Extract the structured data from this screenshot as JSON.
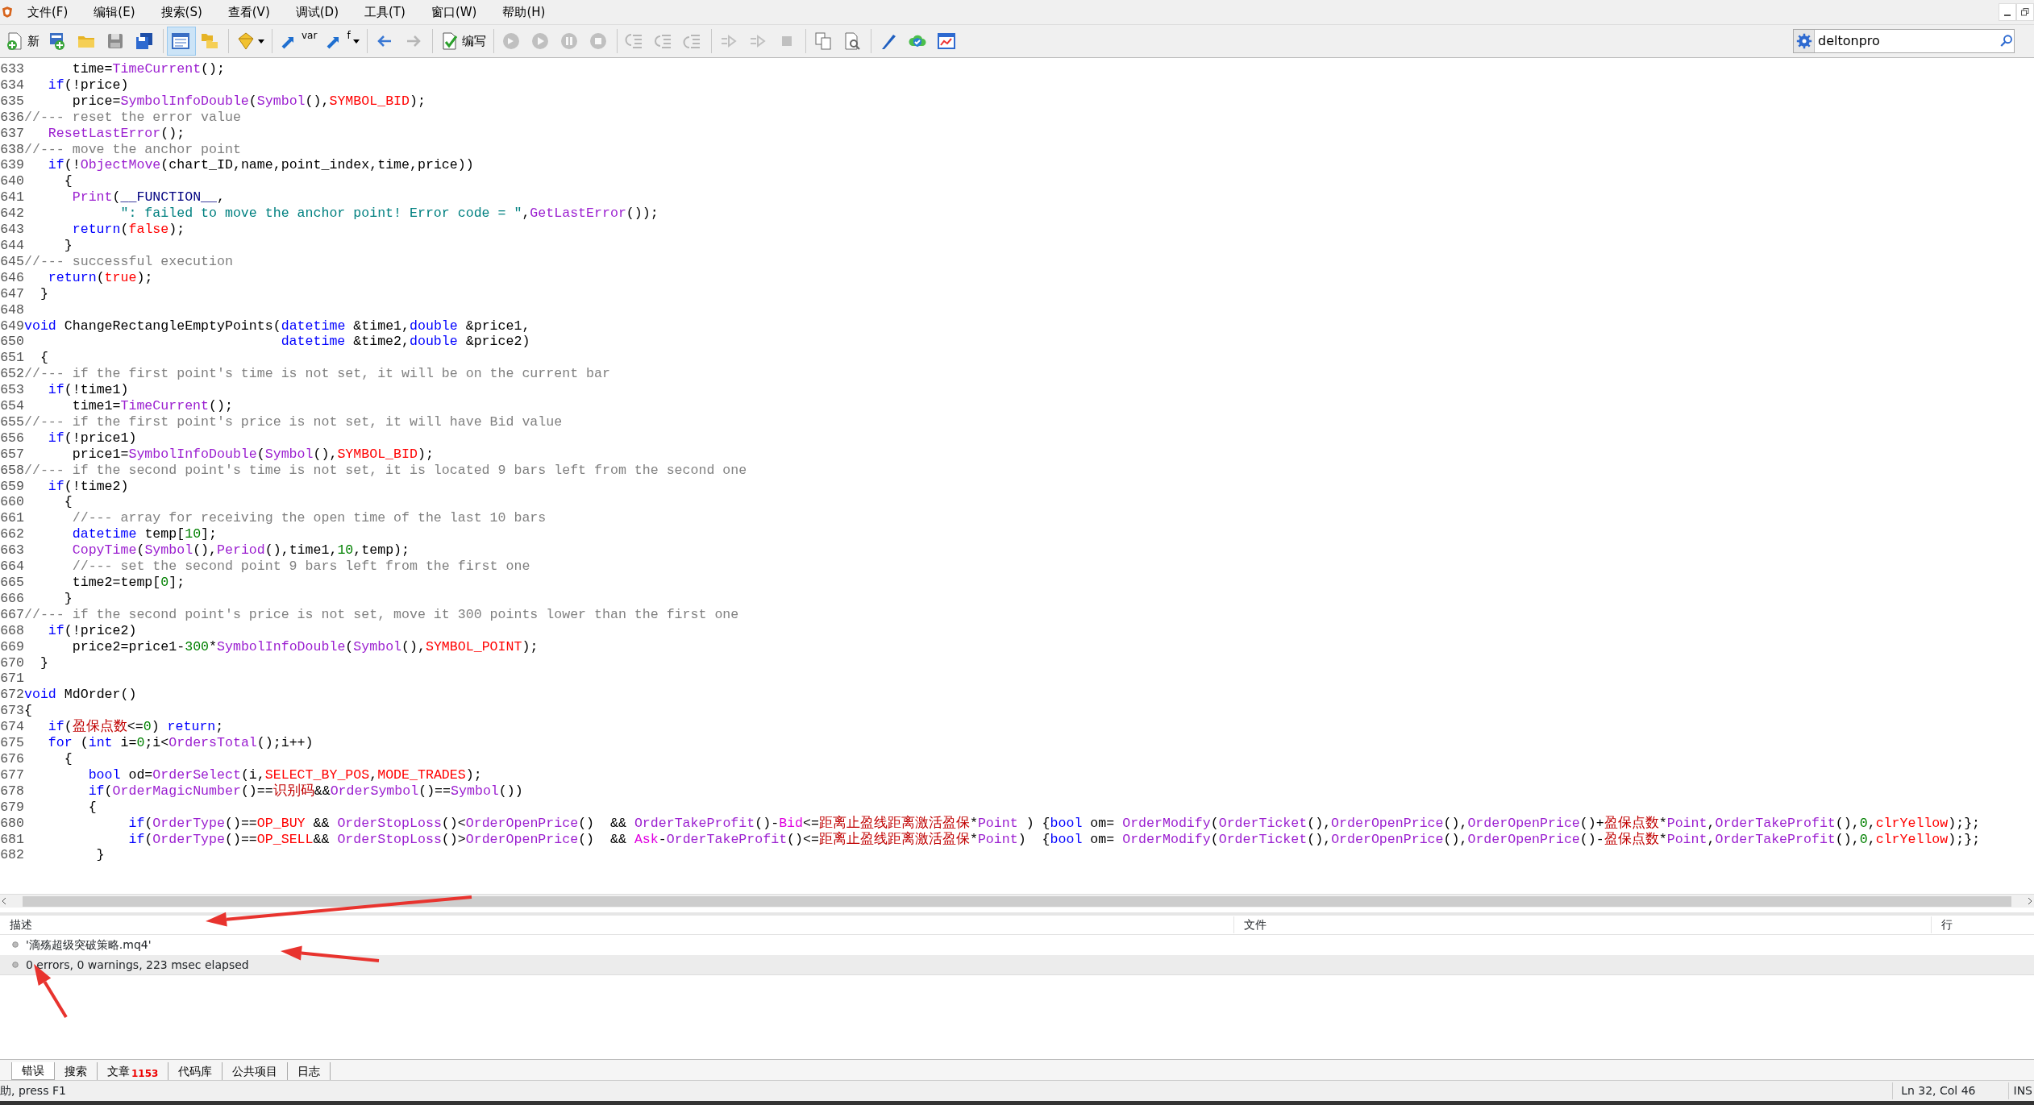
{
  "menu": [
    {
      "label": "文件(F)"
    },
    {
      "label": "编辑(E)"
    },
    {
      "label": "搜索(S)"
    },
    {
      "label": "查看(V)"
    },
    {
      "label": "调试(D)"
    },
    {
      "label": "工具(T)"
    },
    {
      "label": "窗口(W)"
    },
    {
      "label": "帮助(H)"
    }
  ],
  "toolbar": [
    {
      "kind": "button",
      "label": "新",
      "disabled": false,
      "selected": false
    },
    {
      "kind": "button",
      "disabled": false,
      "selected": false
    },
    {
      "kind": "button",
      "disabled": false,
      "selected": false
    },
    {
      "kind": "button",
      "disabled": false,
      "selected": false
    },
    {
      "kind": "button",
      "disabled": false,
      "selected": false
    },
    {
      "kind": "separator"
    },
    {
      "kind": "button",
      "disabled": false,
      "selected": true
    },
    {
      "kind": "button",
      "disabled": false,
      "selected": false
    },
    {
      "kind": "separator"
    },
    {
      "kind": "dropdown",
      "disabled": false,
      "selected": false
    },
    {
      "kind": "separator"
    },
    {
      "kind": "button",
      "caption": "var",
      "disabled": false,
      "selected": false
    },
    {
      "kind": "dropdown",
      "caption": "f",
      "disabled": false,
      "selected": false
    },
    {
      "kind": "separator"
    },
    {
      "kind": "button",
      "disabled": false,
      "selected": false
    },
    {
      "kind": "button",
      "disabled": true,
      "selected": false
    },
    {
      "kind": "separator"
    },
    {
      "kind": "button",
      "label": "编写",
      "disabled": false,
      "selected": false
    },
    {
      "kind": "separator"
    },
    {
      "kind": "button",
      "disabled": true,
      "selected": false
    },
    {
      "kind": "button",
      "disabled": true,
      "selected": false
    },
    {
      "kind": "button",
      "disabled": true,
      "selected": false
    },
    {
      "kind": "button",
      "disabled": true,
      "selected": false
    },
    {
      "kind": "separator"
    },
    {
      "kind": "button",
      "disabled": true,
      "selected": false
    },
    {
      "kind": "button",
      "disabled": true,
      "selected": false
    },
    {
      "kind": "button",
      "disabled": true,
      "selected": false
    },
    {
      "kind": "separator"
    },
    {
      "kind": "button",
      "disabled": true,
      "selected": false
    },
    {
      "kind": "button",
      "disabled": true,
      "selected": false
    },
    {
      "kind": "button",
      "disabled": true,
      "selected": false
    },
    {
      "kind": "separator"
    },
    {
      "kind": "button",
      "disabled": false,
      "selected": false
    },
    {
      "kind": "button",
      "disabled": false,
      "selected": false
    },
    {
      "kind": "separator"
    },
    {
      "kind": "button",
      "disabled": false,
      "selected": false
    },
    {
      "kind": "button",
      "disabled": false,
      "selected": false
    },
    {
      "kind": "button",
      "disabled": false,
      "selected": false
    }
  ],
  "search": {
    "value": "deltonpro"
  },
  "code_lines": [
    {
      "number": "633",
      "tokens": [
        {
          "text": "      time=",
          "kind": "plain"
        },
        {
          "text": "TimeCurrent",
          "kind": "function"
        },
        {
          "text": "();",
          "kind": "plain"
        }
      ]
    },
    {
      "number": "634",
      "tokens": [
        {
          "text": "   if",
          "kind": "keyword"
        },
        {
          "text": "(!price)",
          "kind": "plain"
        }
      ]
    },
    {
      "number": "635",
      "tokens": [
        {
          "text": "      price=",
          "kind": "plain"
        },
        {
          "text": "SymbolInfoDouble",
          "kind": "function"
        },
        {
          "text": "(",
          "kind": "plain"
        },
        {
          "text": "Symbol",
          "kind": "function"
        },
        {
          "text": "(),",
          "kind": "plain"
        },
        {
          "text": "SYMBOL_BID",
          "kind": "constant"
        },
        {
          "text": ");",
          "kind": "plain"
        }
      ]
    },
    {
      "number": "636",
      "tokens": [
        {
          "text": "//--- reset the error value",
          "kind": "comment"
        }
      ]
    },
    {
      "number": "637",
      "tokens": [
        {
          "text": "   ResetLastError",
          "kind": "function"
        },
        {
          "text": "();",
          "kind": "plain"
        }
      ]
    },
    {
      "number": "638",
      "tokens": [
        {
          "text": "//--- move the anchor point",
          "kind": "comment"
        }
      ]
    },
    {
      "number": "639",
      "tokens": [
        {
          "text": "   if",
          "kind": "keyword"
        },
        {
          "text": "(!",
          "kind": "plain"
        },
        {
          "text": "ObjectMove",
          "kind": "function"
        },
        {
          "text": "(chart_ID,name,point_index,time,price))",
          "kind": "plain"
        }
      ]
    },
    {
      "number": "640",
      "tokens": [
        {
          "text": "     {",
          "kind": "plain"
        }
      ]
    },
    {
      "number": "641",
      "tokens": [
        {
          "text": "      Print",
          "kind": "function"
        },
        {
          "text": "(",
          "kind": "plain"
        },
        {
          "text": "__FUNCTION__",
          "kind": "macro"
        },
        {
          "text": ",",
          "kind": "plain"
        }
      ]
    },
    {
      "number": "642",
      "tokens": [
        {
          "text": "            \": failed to move the anchor point! Error code = \"",
          "kind": "string"
        },
        {
          "text": ",",
          "kind": "plain"
        },
        {
          "text": "GetLastError",
          "kind": "function"
        },
        {
          "text": "());",
          "kind": "plain"
        }
      ]
    },
    {
      "number": "643",
      "tokens": [
        {
          "text": "      return",
          "kind": "keyword"
        },
        {
          "text": "(",
          "kind": "plain"
        },
        {
          "text": "false",
          "kind": "constant"
        },
        {
          "text": ");",
          "kind": "plain"
        }
      ]
    },
    {
      "number": "644",
      "tokens": [
        {
          "text": "     }",
          "kind": "plain"
        }
      ]
    },
    {
      "number": "645",
      "tokens": [
        {
          "text": "//--- successful execution",
          "kind": "comment"
        }
      ]
    },
    {
      "number": "646",
      "tokens": [
        {
          "text": "   return",
          "kind": "keyword"
        },
        {
          "text": "(",
          "kind": "plain"
        },
        {
          "text": "true",
          "kind": "constant"
        },
        {
          "text": ");",
          "kind": "plain"
        }
      ]
    },
    {
      "number": "647",
      "tokens": [
        {
          "text": "  }",
          "kind": "plain"
        }
      ]
    },
    {
      "number": "648"
    },
    {
      "number": "649",
      "tokens": [
        {
          "text": "void",
          "kind": "keyword"
        },
        {
          "text": " ChangeRectangleEmptyPoints(",
          "kind": "plain"
        },
        {
          "text": "datetime",
          "kind": "keyword"
        },
        {
          "text": " &time1,",
          "kind": "plain"
        },
        {
          "text": "double",
          "kind": "keyword"
        },
        {
          "text": " &price1,",
          "kind": "plain"
        }
      ]
    },
    {
      "number": "650",
      "tokens": [
        {
          "text": "                                datetime",
          "kind": "keyword"
        },
        {
          "text": " &time2,",
          "kind": "plain"
        },
        {
          "text": "double",
          "kind": "keyword"
        },
        {
          "text": " &price2)",
          "kind": "plain"
        }
      ]
    },
    {
      "number": "651",
      "tokens": [
        {
          "text": "  {",
          "kind": "plain"
        }
      ]
    },
    {
      "number": "652",
      "tokens": [
        {
          "text": "//--- if the first point's time is not set, it will be on the current bar",
          "kind": "comment"
        }
      ]
    },
    {
      "number": "653",
      "tokens": [
        {
          "text": "   if",
          "kind": "keyword"
        },
        {
          "text": "(!time1)",
          "kind": "plain"
        }
      ]
    },
    {
      "number": "654",
      "tokens": [
        {
          "text": "      time1=",
          "kind": "plain"
        },
        {
          "text": "TimeCurrent",
          "kind": "function"
        },
        {
          "text": "();",
          "kind": "plain"
        }
      ]
    },
    {
      "number": "655",
      "tokens": [
        {
          "text": "//--- if the first point's price is not set, it will have Bid value",
          "kind": "comment"
        }
      ]
    },
    {
      "number": "656",
      "tokens": [
        {
          "text": "   if",
          "kind": "keyword"
        },
        {
          "text": "(!price1)",
          "kind": "plain"
        }
      ]
    },
    {
      "number": "657",
      "tokens": [
        {
          "text": "      price1=",
          "kind": "plain"
        },
        {
          "text": "SymbolInfoDouble",
          "kind": "function"
        },
        {
          "text": "(",
          "kind": "plain"
        },
        {
          "text": "Symbol",
          "kind": "function"
        },
        {
          "text": "(),",
          "kind": "plain"
        },
        {
          "text": "SYMBOL_BID",
          "kind": "constant"
        },
        {
          "text": ");",
          "kind": "plain"
        }
      ]
    },
    {
      "number": "658",
      "tokens": [
        {
          "text": "//--- if the second point's time is not set, it is located 9 bars left from the second one",
          "kind": "comment"
        }
      ]
    },
    {
      "number": "659",
      "tokens": [
        {
          "text": "   if",
          "kind": "keyword"
        },
        {
          "text": "(!time2)",
          "kind": "plain"
        }
      ]
    },
    {
      "number": "660",
      "tokens": [
        {
          "text": "     {",
          "kind": "plain"
        }
      ]
    },
    {
      "number": "661",
      "tokens": [
        {
          "text": "      //--- array for receiving the open time of the last 10 bars",
          "kind": "comment"
        }
      ]
    },
    {
      "number": "662",
      "tokens": [
        {
          "text": "      datetime",
          "kind": "keyword"
        },
        {
          "text": " temp[",
          "kind": "plain"
        },
        {
          "text": "10",
          "kind": "number"
        },
        {
          "text": "];",
          "kind": "plain"
        }
      ]
    },
    {
      "number": "663",
      "tokens": [
        {
          "text": "      CopyTime",
          "kind": "function"
        },
        {
          "text": "(",
          "kind": "plain"
        },
        {
          "text": "Symbol",
          "kind": "function"
        },
        {
          "text": "(),",
          "kind": "plain"
        },
        {
          "text": "Period",
          "kind": "function"
        },
        {
          "text": "(),time1,",
          "kind": "plain"
        },
        {
          "text": "10",
          "kind": "number"
        },
        {
          "text": ",temp);",
          "kind": "plain"
        }
      ]
    },
    {
      "number": "664",
      "tokens": [
        {
          "text": "      //--- set the second point 9 bars left from the first one",
          "kind": "comment"
        }
      ]
    },
    {
      "number": "665",
      "tokens": [
        {
          "text": "      time2=temp[",
          "kind": "plain"
        },
        {
          "text": "0",
          "kind": "number"
        },
        {
          "text": "];",
          "kind": "plain"
        }
      ]
    },
    {
      "number": "666",
      "tokens": [
        {
          "text": "     }",
          "kind": "plain"
        }
      ]
    },
    {
      "number": "667",
      "tokens": [
        {
          "text": "//--- if the second point's price is not set, move it 300 points lower than the first one",
          "kind": "comment"
        }
      ]
    },
    {
      "number": "668",
      "tokens": [
        {
          "text": "   if",
          "kind": "keyword"
        },
        {
          "text": "(!price2)",
          "kind": "plain"
        }
      ]
    },
    {
      "number": "669",
      "tokens": [
        {
          "text": "      price2=price1-",
          "kind": "plain"
        },
        {
          "text": "300",
          "kind": "number"
        },
        {
          "text": "*",
          "kind": "plain"
        },
        {
          "text": "SymbolInfoDouble",
          "kind": "function"
        },
        {
          "text": "(",
          "kind": "plain"
        },
        {
          "text": "Symbol",
          "kind": "function"
        },
        {
          "text": "(),",
          "kind": "plain"
        },
        {
          "text": "SYMBOL_POINT",
          "kind": "constant"
        },
        {
          "text": ");",
          "kind": "plain"
        }
      ]
    },
    {
      "number": "670",
      "tokens": [
        {
          "text": "  }",
          "kind": "plain"
        }
      ]
    },
    {
      "number": "671"
    },
    {
      "number": "672",
      "tokens": [
        {
          "text": "void",
          "kind": "keyword"
        },
        {
          "text": " MdOrder()",
          "kind": "plain"
        }
      ]
    },
    {
      "number": "673",
      "tokens": [
        {
          "text": "{",
          "kind": "plain"
        }
      ]
    },
    {
      "number": "674",
      "tokens": [
        {
          "text": "   if",
          "kind": "keyword"
        },
        {
          "text": "(",
          "kind": "plain"
        },
        {
          "text": "盈保点数",
          "kind": "variable"
        },
        {
          "text": "<=",
          "kind": "plain"
        },
        {
          "text": "0",
          "kind": "number"
        },
        {
          "text": ") ",
          "kind": "plain"
        },
        {
          "text": "return",
          "kind": "keyword"
        },
        {
          "text": ";",
          "kind": "plain"
        }
      ]
    },
    {
      "number": "675",
      "tokens": [
        {
          "text": "   for",
          "kind": "keyword"
        },
        {
          "text": " (",
          "kind": "plain"
        },
        {
          "text": "int",
          "kind": "keyword"
        },
        {
          "text": " i=",
          "kind": "plain"
        },
        {
          "text": "0",
          "kind": "number"
        },
        {
          "text": ";i<",
          "kind": "plain"
        },
        {
          "text": "OrdersTotal",
          "kind": "function"
        },
        {
          "text": "();i++)",
          "kind": "plain"
        }
      ]
    },
    {
      "number": "676",
      "tokens": [
        {
          "text": "     {",
          "kind": "plain"
        }
      ]
    },
    {
      "number": "677",
      "tokens": [
        {
          "text": "        bool",
          "kind": "keyword"
        },
        {
          "text": " od=",
          "kind": "plain"
        },
        {
          "text": "OrderSelect",
          "kind": "function"
        },
        {
          "text": "(i,",
          "kind": "plain"
        },
        {
          "text": "SELECT_BY_POS",
          "kind": "constant"
        },
        {
          "text": ",",
          "kind": "plain"
        },
        {
          "text": "MODE_TRADES",
          "kind": "constant"
        },
        {
          "text": ");",
          "kind": "plain"
        }
      ]
    },
    {
      "number": "678",
      "tokens": [
        {
          "text": "        if",
          "kind": "keyword"
        },
        {
          "text": "(",
          "kind": "plain"
        },
        {
          "text": "OrderMagicNumber",
          "kind": "function"
        },
        {
          "text": "()==",
          "kind": "plain"
        },
        {
          "text": "识别码",
          "kind": "variable"
        },
        {
          "text": "&&",
          "kind": "plain"
        },
        {
          "text": "OrderSymbol",
          "kind": "function"
        },
        {
          "text": "()==",
          "kind": "plain"
        },
        {
          "text": "Symbol",
          "kind": "function"
        },
        {
          "text": "())",
          "kind": "plain"
        }
      ]
    },
    {
      "number": "679",
      "tokens": [
        {
          "text": "        {",
          "kind": "plain"
        }
      ]
    },
    {
      "number": "680",
      "tokens": [
        {
          "text": "             if",
          "kind": "keyword"
        },
        {
          "text": "(",
          "kind": "plain"
        },
        {
          "text": "OrderType",
          "kind": "function"
        },
        {
          "text": "()==",
          "kind": "plain"
        },
        {
          "text": "OP_BUY",
          "kind": "constant"
        },
        {
          "text": " && ",
          "kind": "plain"
        },
        {
          "text": "OrderStopLoss",
          "kind": "function"
        },
        {
          "text": "()<",
          "kind": "plain"
        },
        {
          "text": "OrderOpenPrice",
          "kind": "function"
        },
        {
          "text": "()  && ",
          "kind": "plain"
        },
        {
          "text": "OrderTakeProfit",
          "kind": "function"
        },
        {
          "text": "()-",
          "kind": "plain"
        },
        {
          "text": "Bid",
          "kind": "predefined"
        },
        {
          "text": "<=",
          "kind": "plain"
        },
        {
          "text": "距离止盈线距离激活盈保",
          "kind": "variable"
        },
        {
          "text": "*",
          "kind": "plain"
        },
        {
          "text": "Point",
          "kind": "function"
        },
        {
          "text": " ) {",
          "kind": "plain"
        },
        {
          "text": "bool",
          "kind": "keyword"
        },
        {
          "text": " om= ",
          "kind": "plain"
        },
        {
          "text": "OrderModify",
          "kind": "function"
        },
        {
          "text": "(",
          "kind": "plain"
        },
        {
          "text": "OrderTicket",
          "kind": "function"
        },
        {
          "text": "(),",
          "kind": "plain"
        },
        {
          "text": "OrderOpenPrice",
          "kind": "function"
        },
        {
          "text": "(),",
          "kind": "plain"
        },
        {
          "text": "OrderOpenPrice",
          "kind": "function"
        },
        {
          "text": "()+",
          "kind": "plain"
        },
        {
          "text": "盈保点数",
          "kind": "variable"
        },
        {
          "text": "*",
          "kind": "plain"
        },
        {
          "text": "Point",
          "kind": "function"
        },
        {
          "text": ",",
          "kind": "plain"
        },
        {
          "text": "OrderTakeProfit",
          "kind": "function"
        },
        {
          "text": "(),",
          "kind": "plain"
        },
        {
          "text": "0",
          "kind": "number"
        },
        {
          "text": ",",
          "kind": "plain"
        },
        {
          "text": "clrYellow",
          "kind": "constant"
        },
        {
          "text": ");};",
          "kind": "plain"
        }
      ]
    },
    {
      "number": "681",
      "tokens": [
        {
          "text": "             if",
          "kind": "keyword"
        },
        {
          "text": "(",
          "kind": "plain"
        },
        {
          "text": "OrderType",
          "kind": "function"
        },
        {
          "text": "()==",
          "kind": "plain"
        },
        {
          "text": "OP_SELL",
          "kind": "constant"
        },
        {
          "text": "&& ",
          "kind": "plain"
        },
        {
          "text": "OrderStopLoss",
          "kind": "function"
        },
        {
          "text": "()>",
          "kind": "plain"
        },
        {
          "text": "OrderOpenPrice",
          "kind": "function"
        },
        {
          "text": "()  && ",
          "kind": "plain"
        },
        {
          "text": "Ask",
          "kind": "predefined"
        },
        {
          "text": "-",
          "kind": "plain"
        },
        {
          "text": "OrderTakeProfit",
          "kind": "function"
        },
        {
          "text": "()<=",
          "kind": "plain"
        },
        {
          "text": "距离止盈线距离激活盈保",
          "kind": "variable"
        },
        {
          "text": "*",
          "kind": "plain"
        },
        {
          "text": "Point",
          "kind": "function"
        },
        {
          "text": ")  {",
          "kind": "plain"
        },
        {
          "text": "bool",
          "kind": "keyword"
        },
        {
          "text": " om= ",
          "kind": "plain"
        },
        {
          "text": "OrderModify",
          "kind": "function"
        },
        {
          "text": "(",
          "kind": "plain"
        },
        {
          "text": "OrderTicket",
          "kind": "function"
        },
        {
          "text": "(),",
          "kind": "plain"
        },
        {
          "text": "OrderOpenPrice",
          "kind": "function"
        },
        {
          "text": "(),",
          "kind": "plain"
        },
        {
          "text": "OrderOpenPrice",
          "kind": "function"
        },
        {
          "text": "()-",
          "kind": "plain"
        },
        {
          "text": "盈保点数",
          "kind": "variable"
        },
        {
          "text": "*",
          "kind": "plain"
        },
        {
          "text": "Point",
          "kind": "function"
        },
        {
          "text": ",",
          "kind": "plain"
        },
        {
          "text": "OrderTakeProfit",
          "kind": "function"
        },
        {
          "text": "(),",
          "kind": "plain"
        },
        {
          "text": "0",
          "kind": "number"
        },
        {
          "text": ",",
          "kind": "plain"
        },
        {
          "text": "clrYellow",
          "kind": "constant"
        },
        {
          "text": ");};",
          "kind": "plain"
        }
      ]
    },
    {
      "number": "682",
      "tokens": [
        {
          "text": "         }",
          "kind": "plain"
        }
      ]
    }
  ],
  "output": {
    "columns": [
      "描述",
      "文件",
      "行"
    ],
    "rows": [
      {
        "description": "'滴殇超级突破策略.mq4'",
        "selected": false
      },
      {
        "description": "0 errors, 0 warnings, 223 msec elapsed",
        "selected": true
      }
    ]
  },
  "bottom_tabs": [
    {
      "label": "错误",
      "selected": true
    },
    {
      "label": "搜索",
      "selected": false
    },
    {
      "label": "文章",
      "badge": "1153",
      "selected": false
    },
    {
      "label": "代码库",
      "selected": false
    },
    {
      "label": "公共项目",
      "selected": false
    },
    {
      "label": "日志",
      "selected": false
    }
  ],
  "annotations": [
    {
      "kind": "arrow"
    },
    {
      "kind": "arrow"
    },
    {
      "kind": "arrow"
    }
  ],
  "status_bar": {
    "help": "助, press F1",
    "position": "Ln 32, Col 46",
    "mode": "INS"
  }
}
